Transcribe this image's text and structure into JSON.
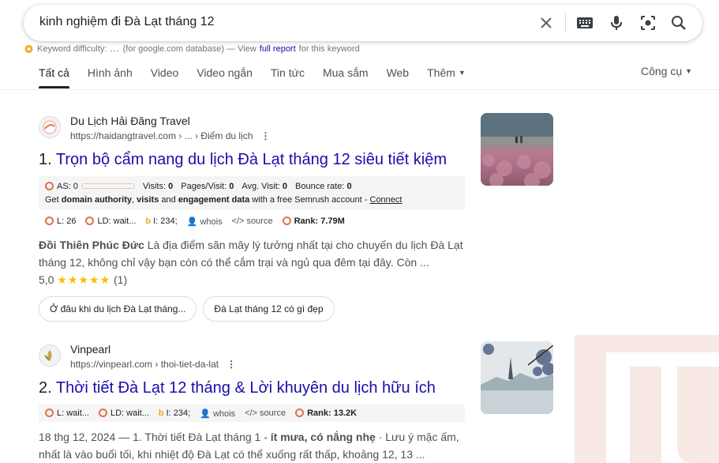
{
  "search": {
    "query": "kinh nghiệm đi Đà Lạt tháng 12",
    "icons": [
      "close-icon",
      "keyboard-icon",
      "microphone-icon",
      "lens-icon",
      "search-icon"
    ]
  },
  "semrush_keyword": {
    "label": "Keyword difficulty:",
    "value": "...",
    "note": "(for google.com database) — View",
    "link": "full report",
    "tail": "for this keyword"
  },
  "tabs": [
    {
      "label": "Tất cả",
      "active": true
    },
    {
      "label": "Hình ảnh"
    },
    {
      "label": "Video"
    },
    {
      "label": "Video ngắn"
    },
    {
      "label": "Tin tức"
    },
    {
      "label": "Mua sắm"
    },
    {
      "label": "Web"
    },
    {
      "label": "Thêm"
    }
  ],
  "tools_label": "Công cụ",
  "results": [
    {
      "site_name": "Du Lịch Hải Đăng Travel",
      "url": "https://haidangtravel.com",
      "breadcrumb": " › ... › Điểm du lịch",
      "number": "1.",
      "title": "Trọn bộ cẩm nang du lịch Đà Lạt tháng 12 siêu tiết kiệm",
      "semrush": {
        "as": "AS: 0",
        "visits_label": "Visits:",
        "visits": "0",
        "pages_label": "Pages/Visit:",
        "pages": "0",
        "avg_label": "Avg. Visit:",
        "avg": "0",
        "bounce_label": "Bounce rate:",
        "bounce": "0",
        "promo_pre": "Get",
        "promo_b1": "domain authority",
        "promo_mid": ",",
        "promo_b2": "visits",
        "promo_and": "and",
        "promo_b3": "engagement data",
        "promo_post": "with a free Semrush account -",
        "promo_link": "Connect"
      },
      "metrics": {
        "l": "L: 26",
        "ld": "LD: wait...",
        "i": "I: 234;",
        "whois": "whois",
        "source": "source",
        "rank": "Rank: 7.79M"
      },
      "snippet_bold": "Đồi Thiên Phúc Đức",
      "snippet": " Là địa điểm săn mây lý tưởng nhất tại cho chuyến du lịch Đà Lạt tháng 12, không chỉ vậy bạn còn có thể cắm trại và ngủ qua đêm tại đây. Còn ...",
      "rating": "5,0",
      "stars": "★★★★★",
      "rating_count": "(1)",
      "chips": [
        "Ở đâu khi du lịch Đà Lạt tháng...",
        "Đà Lạt tháng 12 có gì đẹp"
      ]
    },
    {
      "site_name": "Vinpearl",
      "url": "https://vinpearl.com",
      "breadcrumb": " › thoi-tiet-da-lat",
      "number": "2.",
      "title": "Thời tiết Đà Lạt 12 tháng & Lời khuyên du lịch hữu ích",
      "metrics": {
        "l": "L: wait...",
        "ld": "LD: wait...",
        "i": "I: 234;",
        "whois": "whois",
        "source": "source",
        "rank": "Rank: 13.2K"
      },
      "date": "18 thg 12, 2024",
      "snippet_pre": " — 1. Thời tiết Đà Lạt tháng 1 - ",
      "snippet_bold": "ít mưa, có nắng nhẹ",
      "snippet": " · Lưu ý mặc ấm, nhất là vào buổi tối, khi nhiệt độ Đà Lạt có thể xuống rất thấp, khoảng 12, 13 ..."
    }
  ],
  "colors": {
    "link": "#1a0dab",
    "semrush_accent": "#e2704a",
    "watermark": "#e8a08a"
  }
}
